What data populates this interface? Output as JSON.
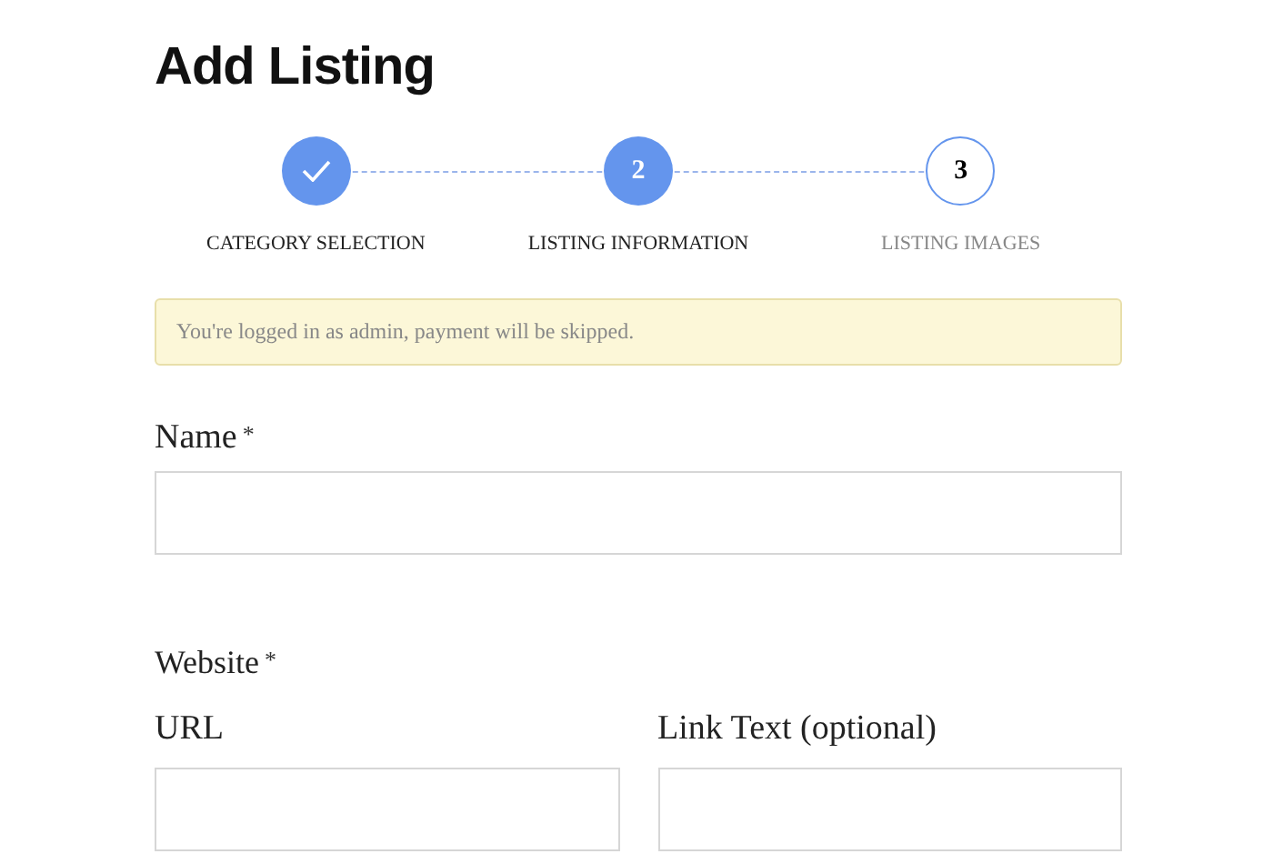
{
  "title": "Add Listing",
  "steps": [
    {
      "label": "CATEGORY SELECTION",
      "kind": "done"
    },
    {
      "label": "LISTING INFORMATION",
      "kind": "current",
      "number": "2"
    },
    {
      "label": "LISTING IMAGES",
      "kind": "upcoming",
      "number": "3"
    }
  ],
  "notice": "You're logged in as admin, payment will be skipped.",
  "name_field": {
    "label": "Name",
    "mark": "*"
  },
  "website": {
    "label": "Website",
    "mark": "*",
    "fields": [
      {
        "label": "URL"
      },
      {
        "label": "Link Text (optional)"
      }
    ]
  }
}
